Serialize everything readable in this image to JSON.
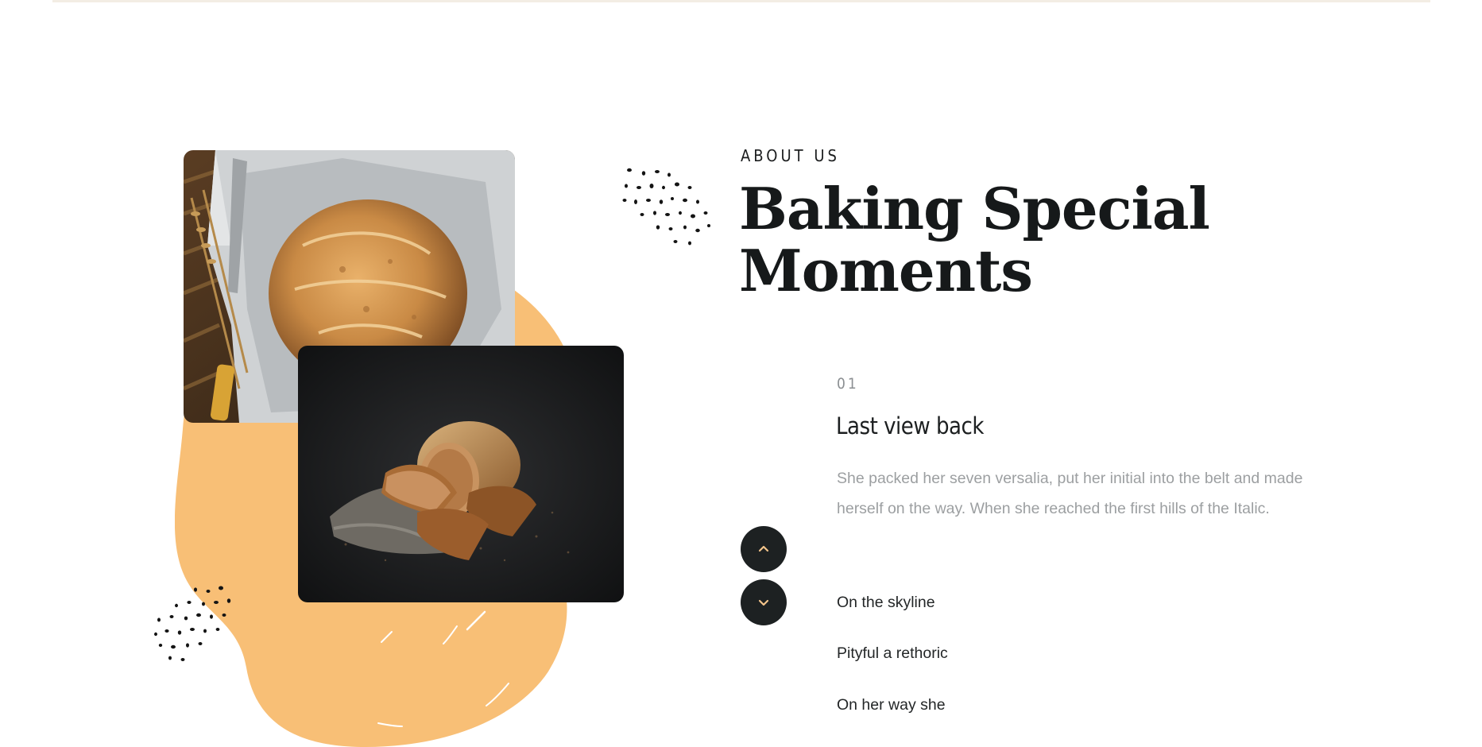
{
  "section": {
    "eyebrow": "ABOUT US",
    "heading_line1": "Baking Special",
    "heading_line2": "Moments"
  },
  "active_item": {
    "number": "01",
    "title": "Last view back",
    "text": "She packed her seven versalia, put her initial into the belt and made herself on the way. When she reached the first hills of the Italic."
  },
  "list_items": [
    {
      "label": "On the skyline"
    },
    {
      "label": "Pityful a rethoric"
    },
    {
      "label": "On her way she"
    }
  ],
  "controls": {
    "up_icon": "chevron-up-icon",
    "down_icon": "chevron-down-icon"
  },
  "colors": {
    "accent_blob": "#f8bf76",
    "dark_button": "#1d2122",
    "chevron": "#f3c48a",
    "heading": "#16191a",
    "muted_text": "#9c9fa1"
  }
}
